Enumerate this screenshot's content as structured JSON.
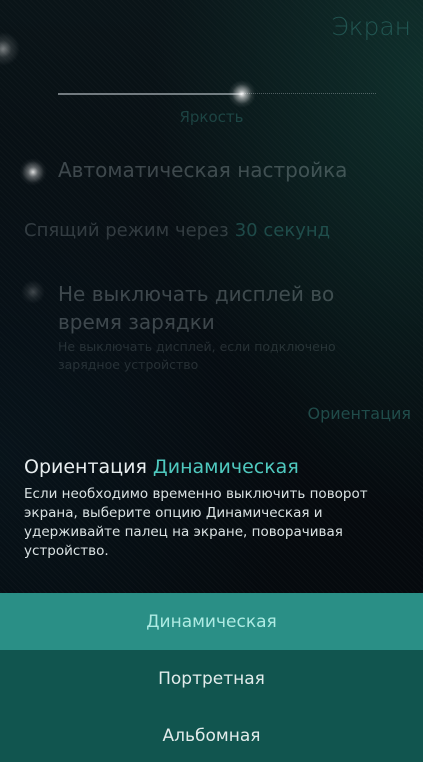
{
  "header": {
    "title": "Экран"
  },
  "brightness": {
    "label": "Яркость",
    "level": 0.58
  },
  "auto_brightness": {
    "label": "Автоматическая настройка",
    "on": true
  },
  "sleep": {
    "label": "Спящий режим через",
    "value": "30 секунд"
  },
  "keep_on": {
    "label": "Не выключать дисплей во время зарядки",
    "description": "Не выключать дисплей, если подключено зарядное устройство",
    "on": false
  },
  "orientation": {
    "section_header": "Ориентация",
    "label": "Ориентация",
    "value": "Динамическая",
    "description": "Если необходимо временно выключить поворот экрана, выберите опцию Динамическая и удерживайте палец на экране, поворачивая устройство."
  },
  "menu": {
    "items": [
      {
        "label": "Динамическая",
        "selected": true
      },
      {
        "label": "Портретная",
        "selected": false
      },
      {
        "label": "Альбомная",
        "selected": false
      }
    ]
  },
  "colors": {
    "accent": "#4fc9bf",
    "menu_selected": "#2a8f86",
    "menu_bg": "#11554f"
  }
}
